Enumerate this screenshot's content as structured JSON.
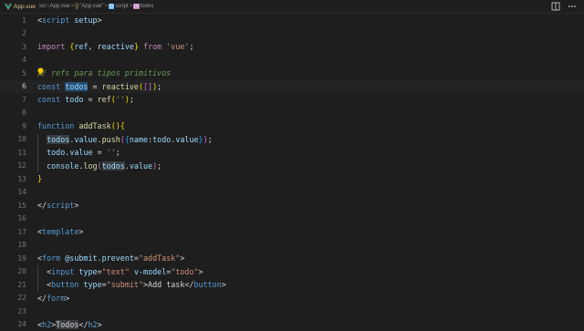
{
  "tab": {
    "name": "App.vue",
    "breadcrumb": [
      "src",
      "App.vue",
      "\"App.vue\"",
      "script",
      "todos"
    ]
  },
  "editor": {
    "current_line": 6,
    "lines": [
      {
        "n": "1",
        "tokens": [
          [
            "t-pun",
            "<"
          ],
          [
            "t-tag",
            "script"
          ],
          [
            "t-pun",
            " "
          ],
          [
            "t-attr",
            "setup"
          ],
          [
            "t-pun",
            ">"
          ]
        ]
      },
      {
        "n": "2",
        "tokens": []
      },
      {
        "n": "3",
        "tokens": [
          [
            "t-kw",
            "import"
          ],
          [
            "t-pun",
            " "
          ],
          [
            "t-br1",
            "{"
          ],
          [
            "t-var",
            "ref"
          ],
          [
            "t-pun",
            ", "
          ],
          [
            "t-var",
            "reactive"
          ],
          [
            "t-br1",
            "}"
          ],
          [
            "t-pun",
            " "
          ],
          [
            "t-kw",
            "from"
          ],
          [
            "t-pun",
            " "
          ],
          [
            "t-str",
            "'vue'"
          ],
          [
            "t-pun",
            ";"
          ]
        ]
      },
      {
        "n": "4",
        "tokens": []
      },
      {
        "n": "5",
        "tokens": [
          [
            "t-cmt",
            "// refs para tipos primitivos"
          ]
        ]
      },
      {
        "n": "6",
        "tokens": [
          [
            "t-kw2",
            "const"
          ],
          [
            "t-pun",
            " "
          ],
          [
            "t-var hl",
            "todos"
          ],
          [
            "t-pun",
            " = "
          ],
          [
            "t-fn",
            "reactive"
          ],
          [
            "t-br1",
            "("
          ],
          [
            "t-br2",
            "[]"
          ],
          [
            "t-br1",
            ")"
          ],
          [
            "t-pun",
            ";"
          ]
        ]
      },
      {
        "n": "7",
        "tokens": [
          [
            "t-kw2",
            "const"
          ],
          [
            "t-pun",
            " "
          ],
          [
            "t-var",
            "todo"
          ],
          [
            "t-pun",
            " = "
          ],
          [
            "t-fn",
            "ref"
          ],
          [
            "t-br1",
            "("
          ],
          [
            "t-str",
            "''"
          ],
          [
            "t-br1",
            ")"
          ],
          [
            "t-pun",
            ";"
          ]
        ]
      },
      {
        "n": "8",
        "tokens": []
      },
      {
        "n": "9",
        "tokens": [
          [
            "t-kw2",
            "function"
          ],
          [
            "t-pun",
            " "
          ],
          [
            "t-fn",
            "addTask"
          ],
          [
            "t-br1",
            "()"
          ],
          [
            "t-br1",
            "{"
          ]
        ]
      },
      {
        "n": "10",
        "tokens": [
          [
            "t-pun",
            "  "
          ],
          [
            "t-var hl2",
            "todos"
          ],
          [
            "t-pun",
            "."
          ],
          [
            "t-var",
            "value"
          ],
          [
            "t-pun",
            "."
          ],
          [
            "t-fn",
            "push"
          ],
          [
            "t-br2",
            "("
          ],
          [
            "t-br3",
            "{"
          ],
          [
            "t-var",
            "name"
          ],
          [
            "t-pun",
            ":"
          ],
          [
            "t-var",
            "todo"
          ],
          [
            "t-pun",
            "."
          ],
          [
            "t-var",
            "value"
          ],
          [
            "t-br3",
            "}"
          ],
          [
            "t-br2",
            ")"
          ],
          [
            "t-pun",
            ";"
          ]
        ]
      },
      {
        "n": "11",
        "tokens": [
          [
            "t-pun",
            "  "
          ],
          [
            "t-var",
            "todo"
          ],
          [
            "t-pun",
            "."
          ],
          [
            "t-var",
            "value"
          ],
          [
            "t-pun",
            " = "
          ],
          [
            "t-str",
            "''"
          ],
          [
            "t-pun",
            ";"
          ]
        ]
      },
      {
        "n": "12",
        "tokens": [
          [
            "t-pun",
            "  "
          ],
          [
            "t-var",
            "console"
          ],
          [
            "t-pun",
            "."
          ],
          [
            "t-fn",
            "log"
          ],
          [
            "t-br2",
            "("
          ],
          [
            "t-var hl2",
            "todos"
          ],
          [
            "t-pun",
            "."
          ],
          [
            "t-var",
            "value"
          ],
          [
            "t-br2",
            ")"
          ],
          [
            "t-pun",
            ";"
          ]
        ]
      },
      {
        "n": "13",
        "tokens": [
          [
            "t-br1",
            "}"
          ]
        ]
      },
      {
        "n": "14",
        "tokens": []
      },
      {
        "n": "15",
        "tokens": [
          [
            "t-pun",
            "</"
          ],
          [
            "t-tag",
            "script"
          ],
          [
            "t-pun",
            ">"
          ]
        ]
      },
      {
        "n": "16",
        "tokens": []
      },
      {
        "n": "17",
        "tokens": [
          [
            "t-pun",
            "<"
          ],
          [
            "t-tag",
            "template"
          ],
          [
            "t-pun",
            ">"
          ]
        ]
      },
      {
        "n": "18",
        "tokens": []
      },
      {
        "n": "19",
        "tokens": [
          [
            "t-pun",
            "<"
          ],
          [
            "t-tag",
            "form"
          ],
          [
            "t-pun",
            " "
          ],
          [
            "t-attr",
            "@submit.prevent"
          ],
          [
            "t-pun",
            "="
          ],
          [
            "t-str",
            "\"addTask\""
          ],
          [
            "t-pun",
            ">"
          ]
        ]
      },
      {
        "n": "20",
        "tokens": [
          [
            "t-pun",
            "  <"
          ],
          [
            "t-tag",
            "input"
          ],
          [
            "t-pun",
            " "
          ],
          [
            "t-attr",
            "type"
          ],
          [
            "t-pun",
            "="
          ],
          [
            "t-str",
            "\"text\""
          ],
          [
            "t-pun",
            " "
          ],
          [
            "t-attr",
            "v-model"
          ],
          [
            "t-pun",
            "="
          ],
          [
            "t-str",
            "\"todo\""
          ],
          [
            "t-pun",
            ">"
          ]
        ]
      },
      {
        "n": "21",
        "tokens": [
          [
            "t-pun",
            "  <"
          ],
          [
            "t-tag",
            "button"
          ],
          [
            "t-pun",
            " "
          ],
          [
            "t-attr",
            "type"
          ],
          [
            "t-pun",
            "="
          ],
          [
            "t-str",
            "\"submit\""
          ],
          [
            "t-pun",
            ">Add task</"
          ],
          [
            "t-tag",
            "button"
          ],
          [
            "t-pun",
            ">"
          ]
        ]
      },
      {
        "n": "22",
        "tokens": [
          [
            "t-pun",
            "</"
          ],
          [
            "t-tag",
            "form"
          ],
          [
            "t-pun",
            ">"
          ]
        ]
      },
      {
        "n": "23",
        "tokens": []
      },
      {
        "n": "24",
        "tokens": [
          [
            "t-pun",
            "<"
          ],
          [
            "t-tag",
            "h2"
          ],
          [
            "t-pun",
            ">"
          ],
          [
            "t-pun hl2",
            "Todos"
          ],
          [
            "t-pun",
            "</"
          ],
          [
            "t-tag",
            "h2"
          ],
          [
            "t-pun",
            ">"
          ]
        ]
      }
    ]
  }
}
